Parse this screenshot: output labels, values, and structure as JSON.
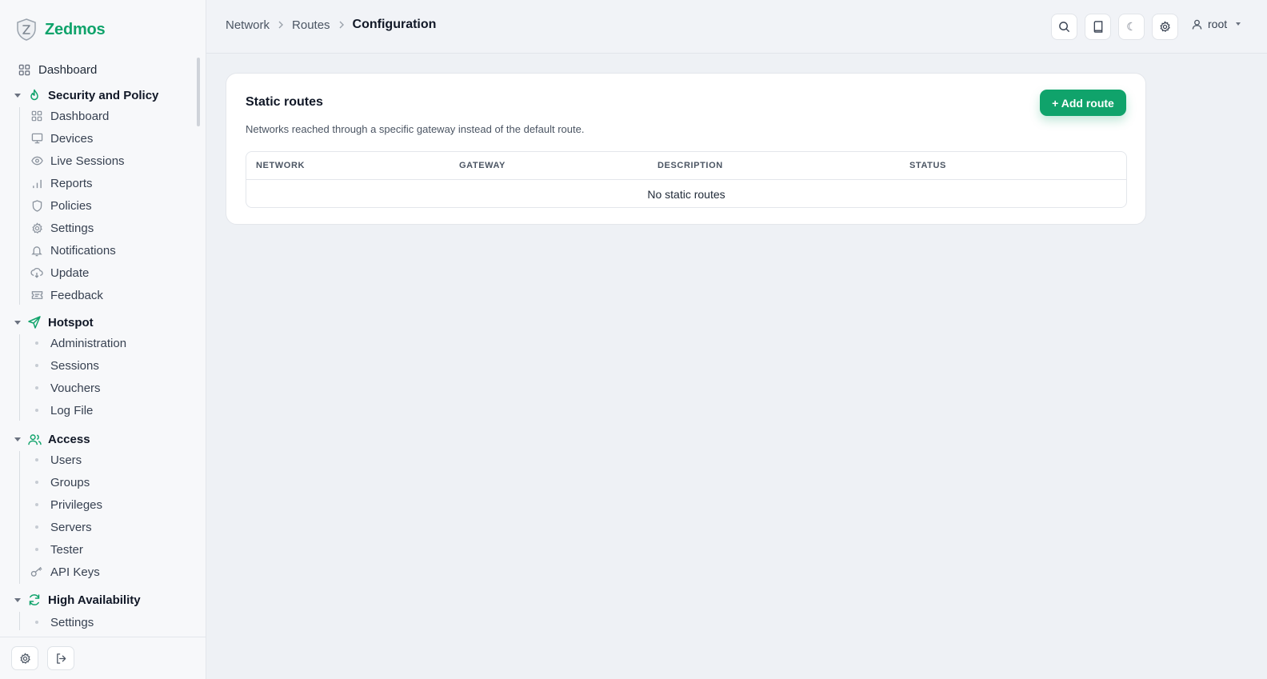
{
  "app": {
    "name": "Zedmos",
    "accent": "#10a36b"
  },
  "sidebar": {
    "top_item": {
      "label": "Dashboard",
      "icon": "grid-icon"
    },
    "sections": [
      {
        "title": "Security and Policy",
        "icon": "flame-icon",
        "items": [
          {
            "label": "Dashboard",
            "icon": "grid-icon"
          },
          {
            "label": "Devices",
            "icon": "monitor-icon"
          },
          {
            "label": "Live Sessions",
            "icon": "eye-icon"
          },
          {
            "label": "Reports",
            "icon": "bar-chart-icon"
          },
          {
            "label": "Policies",
            "icon": "shield-icon"
          },
          {
            "label": "Settings",
            "icon": "gear-icon"
          },
          {
            "label": "Notifications",
            "icon": "bell-icon"
          },
          {
            "label": "Update",
            "icon": "cloud-download-icon"
          },
          {
            "label": "Feedback",
            "icon": "ticket-icon"
          }
        ]
      },
      {
        "title": "Hotspot",
        "icon": "send-icon",
        "items": [
          {
            "label": "Administration"
          },
          {
            "label": "Sessions"
          },
          {
            "label": "Vouchers"
          },
          {
            "label": "Log File"
          }
        ]
      },
      {
        "title": "Access",
        "icon": "users-icon",
        "items": [
          {
            "label": "Users"
          },
          {
            "label": "Groups"
          },
          {
            "label": "Privileges"
          },
          {
            "label": "Servers"
          },
          {
            "label": "Tester"
          },
          {
            "label": "API Keys",
            "icon": "key-icon"
          }
        ]
      },
      {
        "title": "High Availability",
        "icon": "refresh-icon",
        "items": [
          {
            "label": "Settings"
          }
        ]
      }
    ]
  },
  "breadcrumb": {
    "items": [
      "Network",
      "Routes"
    ],
    "current": "Configuration"
  },
  "header": {
    "user": "root"
  },
  "card": {
    "title": "Static routes",
    "description": "Networks reached through a specific gateway instead of the default route.",
    "add_button": "+ Add route",
    "columns": [
      "NETWORK",
      "GATEWAY",
      "DESCRIPTION",
      "STATUS"
    ],
    "empty_text": "No static routes"
  }
}
